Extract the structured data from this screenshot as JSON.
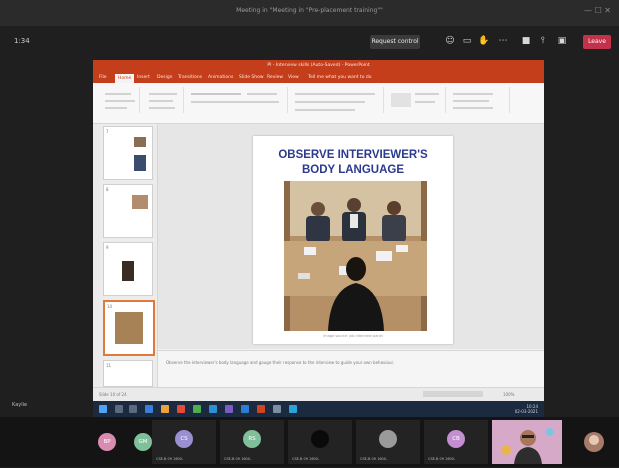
{
  "window": {
    "title": "Meeting in \"Meeting in \"Pre-placement training\"\""
  },
  "meeting": {
    "timer": "1:34",
    "request_control": "Request control",
    "leave": "Leave"
  },
  "ppt": {
    "doc_title": "PI - Interview skills (Auto-Saved) - PowerPoint",
    "tabs": [
      "File",
      "Home",
      "Insert",
      "Design",
      "Transitions",
      "Animations",
      "Slide Show",
      "Review",
      "View",
      "Tell me what you want to do"
    ],
    "active_tab": "Home",
    "thumb_numbers": [
      "7",
      "8",
      "9",
      "10",
      "11"
    ],
    "slide_title_line1": "OBSERVE INTERVIEWER'S",
    "slide_title_line2": "BODY LANGUAGE",
    "caption": "Image source: job interview panel",
    "notes": "Observe the interviewer's body language and gauge their response to the interview to guide your own behaviour.",
    "status_left": "Slide 10 of 24",
    "zoom": "100%"
  },
  "taskbar": {
    "time": "10:24",
    "date": "02-03-2021"
  },
  "presenter_name": "Kaylie",
  "participants": [
    {
      "initials": "BP",
      "color": "#d98cb0",
      "name": ""
    },
    {
      "initials": "GM",
      "color": "#7fbf9a",
      "name": ""
    },
    {
      "initials": "CS",
      "color": "#9a8fd0",
      "name": "CSE-B 09 1600-"
    },
    {
      "initials": "RS",
      "color": "#7fbf9a",
      "name": "CSE-B 09 1600-"
    },
    {
      "initials": "",
      "color": "#0a0a0a",
      "name": "CSE-B 09 1600-"
    },
    {
      "initials": "",
      "color": "#9a9a9a",
      "name": "CSE-B 09 1600-"
    },
    {
      "initials": "CB",
      "color": "#c48fd0",
      "name": "CSE-B 09 1600-"
    }
  ],
  "colors": {
    "accent": "#c43e1c",
    "leave": "#c4314b",
    "slide_title": "#2b3a8f",
    "teams_bg": "#1f1f1f"
  }
}
